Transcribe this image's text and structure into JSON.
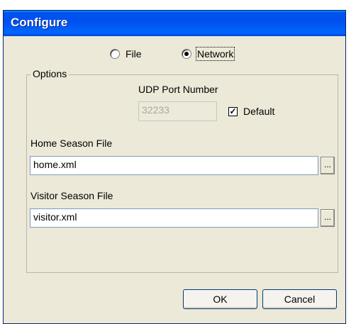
{
  "window": {
    "title": "Configure"
  },
  "mode": {
    "file_label": "File",
    "network_label": "Network",
    "selected": "Network"
  },
  "options": {
    "group_label": "Options",
    "udp_port_label": "UDP Port Number",
    "udp_port_value": "32233",
    "default_label": "Default",
    "default_checked": true,
    "home_label": "Home Season File",
    "home_value": "home.xml",
    "visitor_label": "Visitor Season File",
    "visitor_value": "visitor.xml",
    "browse_label": "..."
  },
  "buttons": {
    "ok_label": "OK",
    "cancel_label": "Cancel"
  },
  "colors": {
    "titlebar": "#0053ee",
    "dialog_bg": "#ece9d8"
  }
}
